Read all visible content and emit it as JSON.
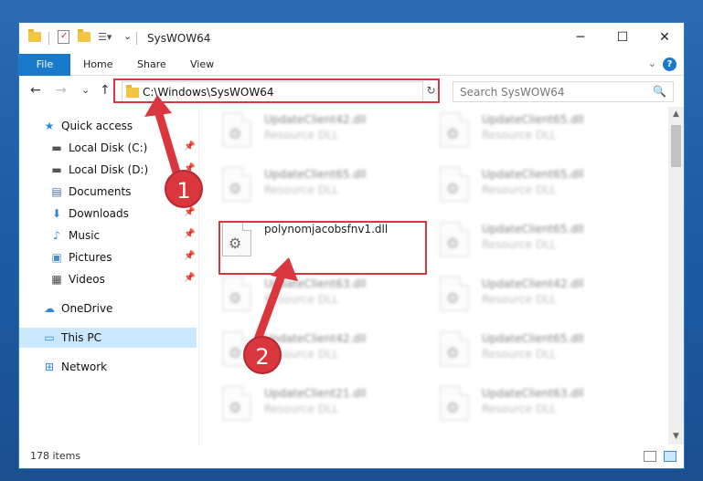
{
  "window": {
    "title": "SysWOW64",
    "minimize_glyph": "─",
    "maximize_glyph": "☐",
    "close_glyph": "✕"
  },
  "ribbon": {
    "tabs": [
      "File",
      "Home",
      "Share",
      "View"
    ],
    "collapse_glyph": "⌄",
    "help_glyph": "?"
  },
  "nav": {
    "back_glyph": "←",
    "forward_glyph": "→",
    "recent_glyph": "⌄",
    "up_glyph": "↑",
    "address": "C:\\Windows\\SysWOW64",
    "address_dropdown_glyph": "⌄",
    "refresh_glyph": "↻",
    "search_placeholder": "Search SysWOW64",
    "search_glyph": "🔍"
  },
  "sidebar": {
    "items": [
      {
        "label": "Quick access",
        "icon": "star-icon",
        "glyph": "★",
        "color": "#2b88d8"
      },
      {
        "label": "Local Disk (C:)",
        "icon": "drive-icon",
        "glyph": "▬",
        "color": "#555555",
        "pinned": true
      },
      {
        "label": "Local Disk (D:)",
        "icon": "drive-icon",
        "glyph": "▬",
        "color": "#555555",
        "pinned": true
      },
      {
        "label": "Documents",
        "icon": "documents-icon",
        "glyph": "▤",
        "color": "#4a6fa5",
        "pinned": true
      },
      {
        "label": "Downloads",
        "icon": "download-icon",
        "glyph": "⬇",
        "color": "#2b88d8",
        "pinned": true
      },
      {
        "label": "Music",
        "icon": "music-icon",
        "glyph": "♪",
        "color": "#2b88d8",
        "pinned": true
      },
      {
        "label": "Pictures",
        "icon": "pictures-icon",
        "glyph": "▣",
        "color": "#4a8ec8",
        "pinned": true
      },
      {
        "label": "Videos",
        "icon": "videos-icon",
        "glyph": "▦",
        "color": "#444444",
        "pinned": true
      },
      {
        "label": "OneDrive",
        "icon": "cloud-icon",
        "glyph": "☁",
        "color": "#2b88d8"
      },
      {
        "label": "This PC",
        "icon": "computer-icon",
        "glyph": "▭",
        "color": "#2b88d8",
        "active": true
      },
      {
        "label": "Network",
        "icon": "network-icon",
        "glyph": "⊞",
        "color": "#2b88d8"
      }
    ],
    "pin_glyph": "📌"
  },
  "files": {
    "type_label": "Resource DLL",
    "left_column": [
      "UpdateClient42.dll",
      "UpdateClient65.dll",
      "polynomjacobsfnv1.dll",
      "UpdateClient63.dll",
      "UpdateClient42.dll",
      "UpdateClient21.dll"
    ],
    "right_column": [
      "UpdateClient65.dll",
      "UpdateClient65.dll",
      "UpdateClient65.dll",
      "UpdateClient42.dll",
      "UpdateClient65.dll",
      "UpdateClient63.dll"
    ],
    "focus_name": "polynomjacobsfnv1.dll",
    "gear_glyph": "⚙"
  },
  "status": {
    "item_count": "178 items"
  },
  "annotations": {
    "marker_1": "1",
    "marker_2": "2",
    "color": "#d9363e"
  }
}
